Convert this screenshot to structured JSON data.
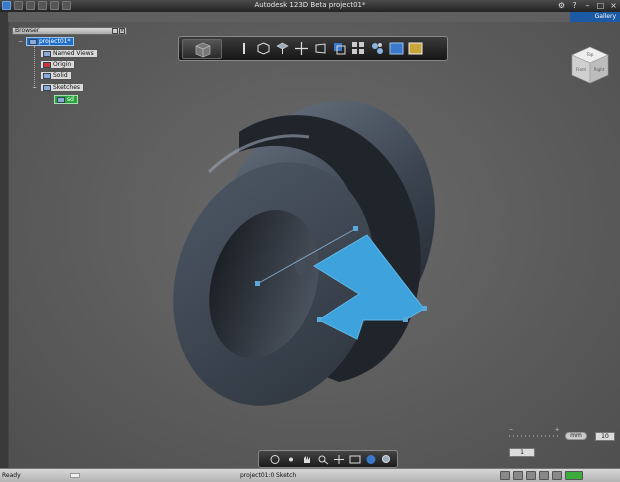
{
  "window": {
    "title": "Autodesk 123D Beta  project01*"
  },
  "gallery": {
    "label": "Gallery"
  },
  "browser": {
    "title": "Browser",
    "root": "project01*",
    "items": [
      {
        "label": "Named Views"
      },
      {
        "label": "Origin"
      },
      {
        "label": "Solid"
      },
      {
        "label": "Sketches"
      },
      {
        "label": "sd"
      }
    ]
  },
  "viewcube": {
    "faces": [
      "Top",
      "Front",
      "Right"
    ]
  },
  "zoom": {
    "unit": "mm",
    "value": "10",
    "step": "1"
  },
  "status": {
    "ready": "Ready",
    "project": "project01:0",
    "mode": "Sketch"
  },
  "colors": {
    "sketch_fill": "#3ea3dd",
    "selection": "#1f6fc8",
    "active_node": "#2aa43d",
    "part": "#3a4350"
  }
}
